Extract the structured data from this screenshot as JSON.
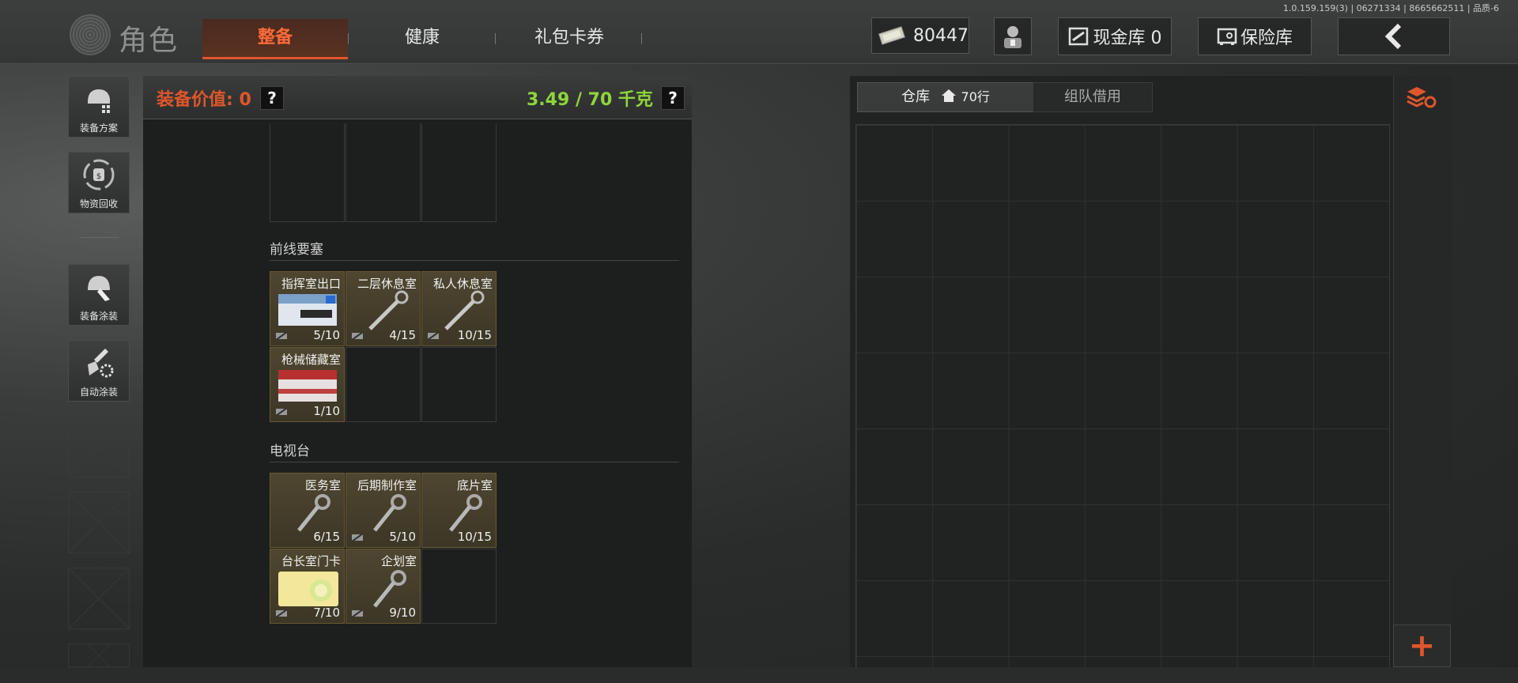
{
  "version": "1.0.159.159(3) | 06271334 | 8665662511 | 品质-6",
  "header": {
    "title": "角色",
    "tabs": [
      "整备",
      "健康",
      "礼包卡券"
    ],
    "money": "80447",
    "cash_vault_label": "现金库 0",
    "safe_label": "保险库"
  },
  "sidebar": {
    "buttons": [
      {
        "label": "装备方案",
        "icon": "helmet-grid-icon"
      },
      {
        "label": "物资回收",
        "icon": "recycle-bag-icon"
      },
      {
        "label": "装备涂装",
        "icon": "helmet-paint-icon"
      },
      {
        "label": "自动涂装",
        "icon": "brush-gear-icon"
      }
    ]
  },
  "equipment": {
    "value_label": "装备价值: 0",
    "weight_label": "3.49 / 70 千克",
    "help": "?"
  },
  "sections": [
    {
      "title": "前线要塞",
      "items": [
        {
          "name": "指挥室出口",
          "count": "5/10",
          "kind": "card",
          "card_num": "3"
        },
        {
          "name": "二层休息室",
          "count": "4/15",
          "kind": "key"
        },
        {
          "name": "私人休息室",
          "count": "10/15",
          "kind": "key"
        },
        {
          "name": "枪械储藏室",
          "count": "1/10",
          "kind": "card",
          "card_num": "01"
        }
      ]
    },
    {
      "title": "电视台",
      "items": [
        {
          "name": "医务室",
          "count": "6/15",
          "kind": "key"
        },
        {
          "name": "后期制作室",
          "count": "5/10",
          "kind": "key"
        },
        {
          "name": "底片室",
          "count": "10/15",
          "kind": "key"
        },
        {
          "name": "台长室门卡",
          "count": "7/10",
          "kind": "yellowcard"
        },
        {
          "name": "企划室",
          "count": "9/10",
          "kind": "key"
        }
      ]
    }
  ],
  "warehouse": {
    "tab_label": "仓库",
    "rows_label": "70行",
    "borrow_label": "组队借用",
    "add": "+"
  },
  "colors": {
    "accent": "#e0562a",
    "weight": "#8fd63a"
  }
}
